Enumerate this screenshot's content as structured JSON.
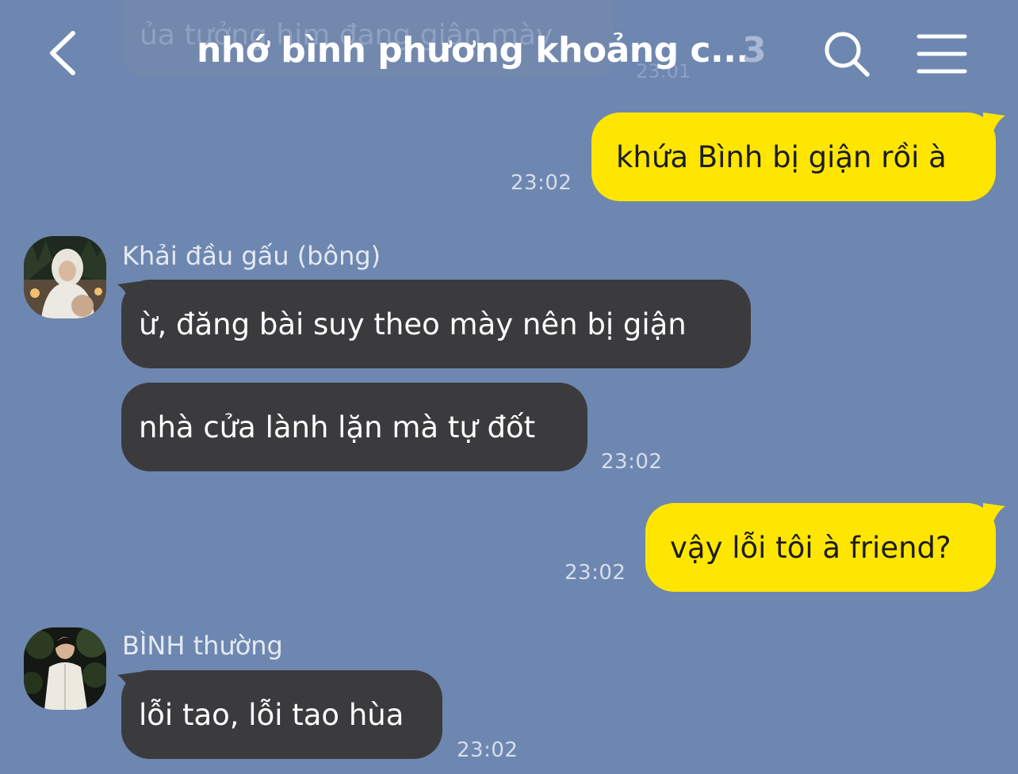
{
  "header": {
    "back_icon": "chevron-left-icon",
    "title": "nhớ bình phương khoảng c...",
    "member_count": "3",
    "search_icon": "search-icon",
    "menu_icon": "hamburger-menu-icon"
  },
  "ghost": {
    "text": "ủa tưởng him đang giận mày",
    "time": "23:01"
  },
  "messages": [
    {
      "text": "khứa Bình bị giận rồi à",
      "time": "23:02"
    },
    {
      "sender": "Khải đầu gấu (bông)",
      "text": "ừ, đăng bài suy theo mày nên bị giận"
    },
    {
      "text": "nhà cửa lành lặn mà tự đốt",
      "time": "23:02"
    },
    {
      "text": "vậy lỗi tôi à friend?",
      "time": "23:02"
    },
    {
      "sender": "BÌNH thường",
      "text": "lỗi tao, lỗi tao hùa",
      "time": "23:02"
    }
  ],
  "colors": {
    "background": "#6d87b0",
    "my_bubble": "#ffe600",
    "their_bubble": "#3b3b3e"
  }
}
